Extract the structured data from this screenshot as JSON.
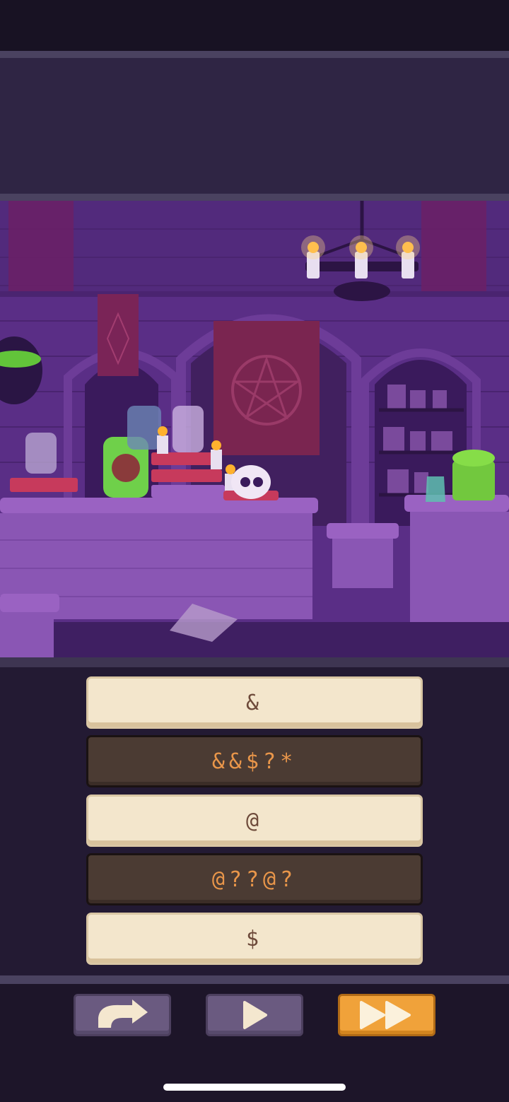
{
  "answers": [
    {
      "text": "&",
      "style": "light"
    },
    {
      "text": "&&$?*",
      "style": "dark"
    },
    {
      "text": "@",
      "style": "light"
    },
    {
      "text": "@??@?",
      "style": "dark"
    },
    {
      "text": "$",
      "style": "light"
    }
  ],
  "controls": {
    "undo_icon": "curved-arrow-icon",
    "play_icon": "play-icon",
    "fast_forward_icon": "fast-forward-icon"
  },
  "colors": {
    "scene_wall": "#5b2f86",
    "accent_orange": "#f0a23a",
    "answer_light": "#f3e6cc",
    "answer_dark": "#4b3b33"
  }
}
